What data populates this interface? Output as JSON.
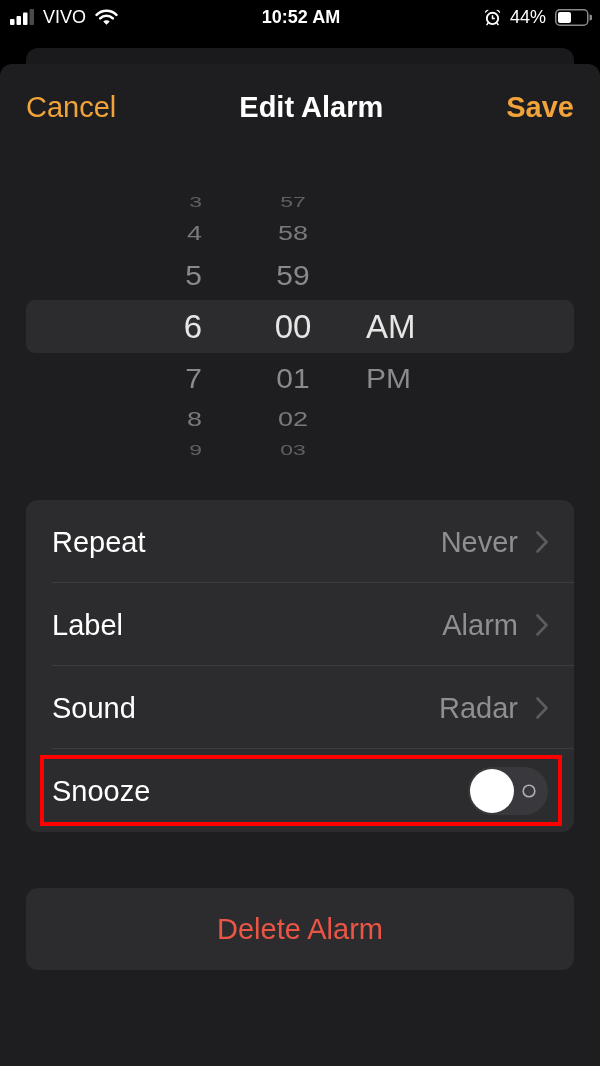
{
  "status_bar": {
    "carrier": "VIVO",
    "time": "10:52 AM",
    "battery": "44%"
  },
  "header": {
    "cancel": "Cancel",
    "title": "Edit Alarm",
    "save": "Save"
  },
  "picker": {
    "columns": [
      {
        "kind": "hour",
        "items": [
          {
            "text": "3",
            "selected": false
          },
          {
            "text": "4",
            "selected": false
          },
          {
            "text": "5",
            "selected": false
          },
          {
            "text": "6",
            "selected": true
          },
          {
            "text": "7",
            "selected": false
          },
          {
            "text": "8",
            "selected": false
          },
          {
            "text": "9",
            "selected": false
          }
        ]
      },
      {
        "kind": "minute",
        "items": [
          {
            "text": "57",
            "selected": false
          },
          {
            "text": "58",
            "selected": false
          },
          {
            "text": "59",
            "selected": false
          },
          {
            "text": "00",
            "selected": true
          },
          {
            "text": "01",
            "selected": false
          },
          {
            "text": "02",
            "selected": false
          },
          {
            "text": "03",
            "selected": false
          }
        ]
      },
      {
        "kind": "period",
        "items": [
          {
            "text": "AM",
            "selected": true
          },
          {
            "text": "PM",
            "selected": false
          }
        ]
      }
    ]
  },
  "settings": [
    {
      "kind": "nav",
      "label": "Repeat",
      "value": "Never",
      "highlighted": false
    },
    {
      "kind": "nav",
      "label": "Label",
      "value": "Alarm",
      "highlighted": false
    },
    {
      "kind": "nav",
      "label": "Sound",
      "value": "Radar",
      "highlighted": false
    },
    {
      "kind": "toggle",
      "label": "Snooze",
      "on": false,
      "highlighted": true
    }
  ],
  "delete_button": "Delete Alarm"
}
